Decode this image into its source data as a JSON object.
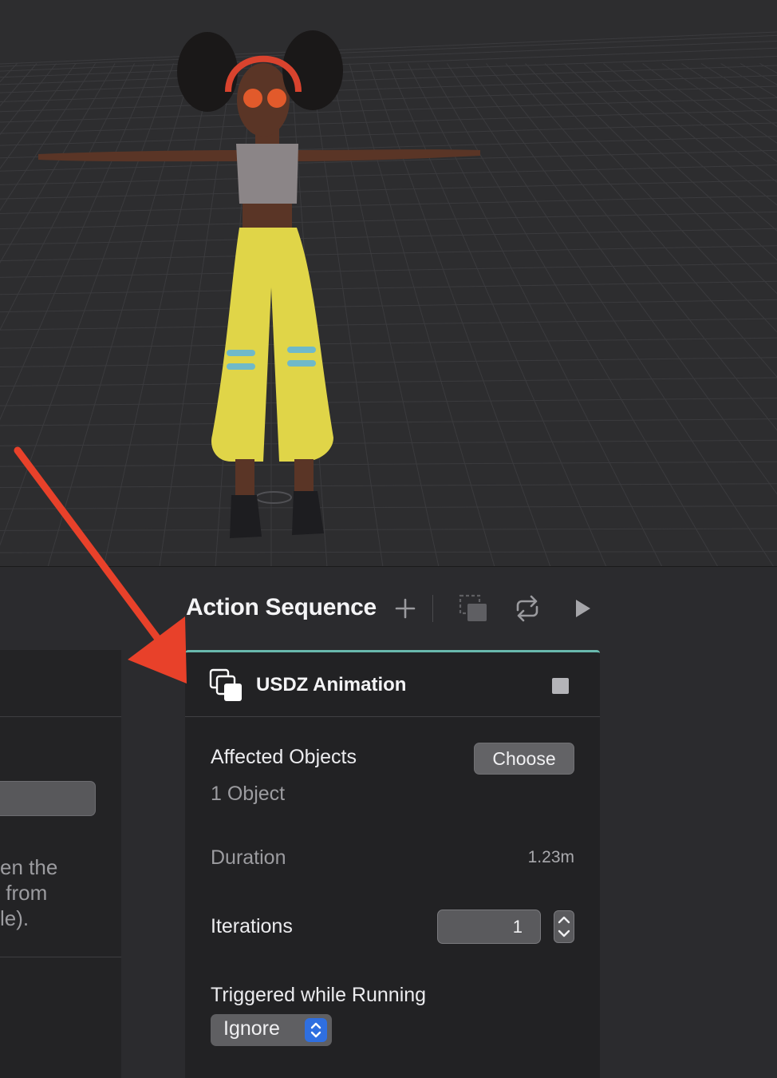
{
  "viewport": {
    "figure": "3d-character-t-pose",
    "grid": true
  },
  "left_panel": {
    "text_lines": "en the\n from\nle)."
  },
  "toolbar": {
    "title": "Action Sequence",
    "add_icon": "plus-icon",
    "duplicate_icon": "duplicate-icon",
    "loop_icon": "loop-icon",
    "play_icon": "play-icon"
  },
  "action_card": {
    "title": "USDZ Animation",
    "icon": "usdz-animation-icon",
    "accent_color": "#69b9ad",
    "affected_objects_label": "Affected Objects",
    "choose_label": "Choose",
    "object_count": "1 Object",
    "duration_label": "Duration",
    "duration_value": "1.23m",
    "iterations_label": "Iterations",
    "iterations_value": "1",
    "triggered_label": "Triggered while Running",
    "triggered_value": "Ignore"
  },
  "annotation": {
    "arrow_color": "#e8412a"
  }
}
